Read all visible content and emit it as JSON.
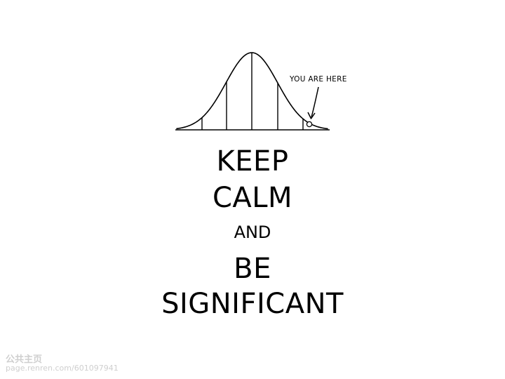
{
  "annotation": {
    "text": "YOU ARE HERE"
  },
  "slogan": {
    "line1": "KEEP",
    "line2": "CALM",
    "line3": "AND",
    "line4": "BE",
    "line5": "SIGNIFICANT"
  },
  "watermark": {
    "logo": "公共主页",
    "url": "page.renren.com/601097941"
  }
}
